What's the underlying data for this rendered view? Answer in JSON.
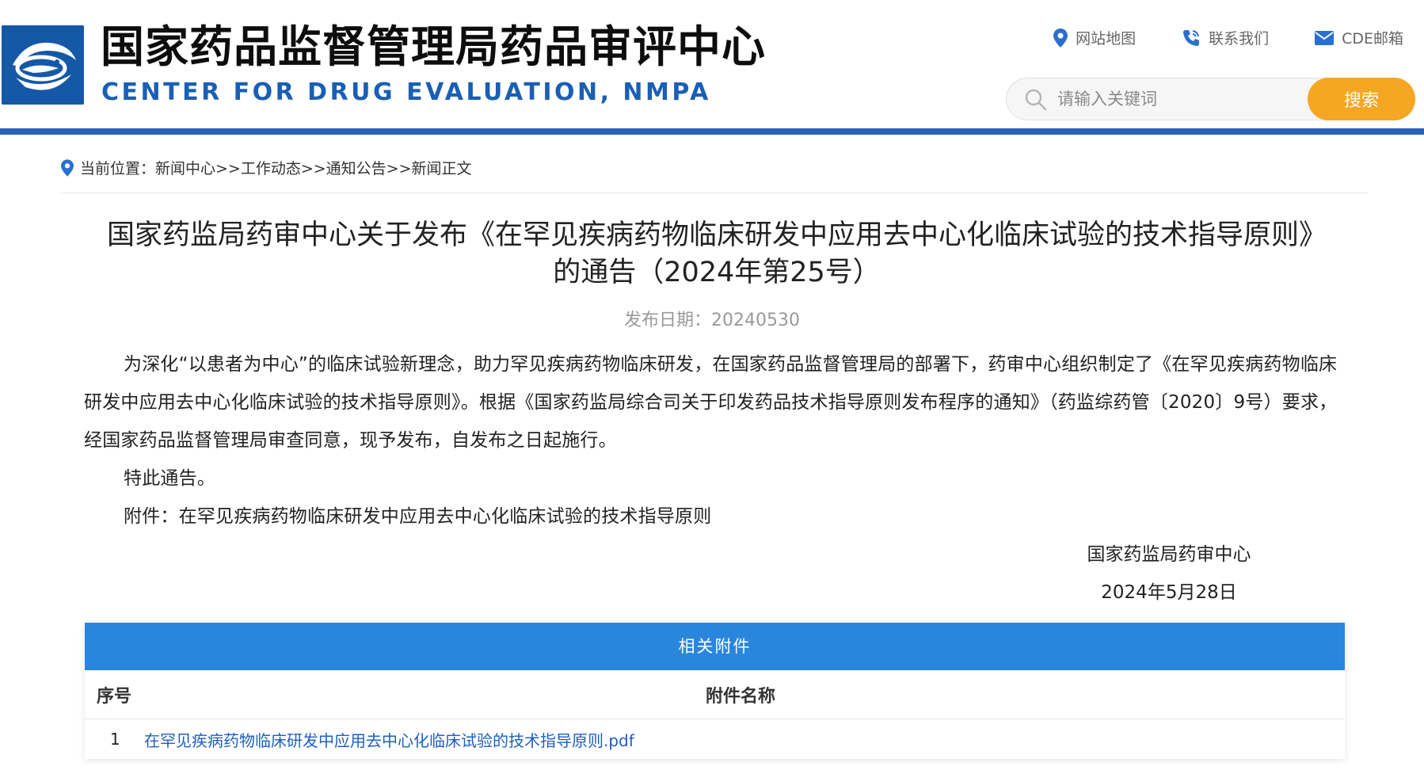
{
  "header": {
    "title": "国家药品监督管理局药品审评中心",
    "subtitle": "CENTER FOR DRUG EVALUATION, NMPA",
    "links": [
      {
        "label": "网站地图",
        "icon": "location-pin-icon"
      },
      {
        "label": "联系我们",
        "icon": "phone-icon"
      },
      {
        "label": "CDE邮箱",
        "icon": "mail-icon"
      }
    ],
    "search": {
      "placeholder": "请输入关键词",
      "button_label": "搜索"
    }
  },
  "breadcrumb": {
    "text": "当前位置：新闻中心>>工作动态>>通知公告>>新闻正文"
  },
  "article": {
    "title_line1": "国家药监局药审中心关于发布《在罕见疾病药物临床研发中应用去中心化临床试验的技术指导原则》",
    "title_line2": "的通告（2024年第25号）",
    "publish_date": "发布日期：20240530",
    "para1": "为深化“以患者为中心”的临床试验新理念，助力罕见疾病药物临床研发，在国家药品监督管理局的部署下，药审中心组织制定了《在罕见疾病药物临床研发中应用去中心化临床试验的技术指导原则》。根据《国家药监局综合司关于印发药品技术指导原则发布程序的通知》（药监综药管〔2020〕9号）要求，经国家药品监督管理局审查同意，现予发布，自发布之日起施行。",
    "para2": "特此通告。",
    "para3": "附件：在罕见疾病药物临床研发中应用去中心化临床试验的技术指导原则",
    "signature_org": "国家药监局药审中心",
    "signature_date": "2024年5月28日"
  },
  "attachments": {
    "heading": "相关附件",
    "col_no": "序号",
    "col_name": "附件名称",
    "rows": [
      {
        "no": "1",
        "name": "在罕见疾病药物临床研发中应用去中心化临床试验的技术指导原则.pdf"
      }
    ]
  },
  "colors": {
    "brand_blue": "#1558a8",
    "rule_blue": "#2b62b7",
    "table_head": "#2a86dd",
    "search_button": "#f5a623",
    "link": "#1f5fbf"
  }
}
